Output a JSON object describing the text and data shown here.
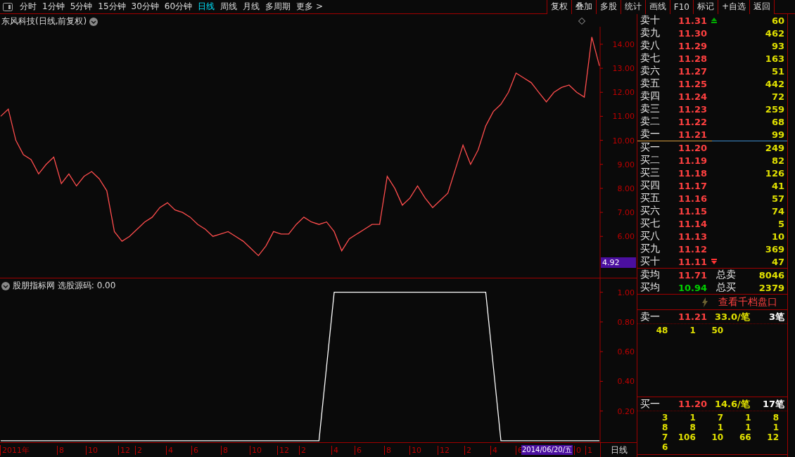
{
  "toolbar": {
    "periods": [
      {
        "label": "分时",
        "selected": false
      },
      {
        "label": "1分钟",
        "selected": false
      },
      {
        "label": "5分钟",
        "selected": false
      },
      {
        "label": "15分钟",
        "selected": false
      },
      {
        "label": "30分钟",
        "selected": false
      },
      {
        "label": "60分钟",
        "selected": false
      },
      {
        "label": "日线",
        "selected": true
      },
      {
        "label": "周线",
        "selected": false
      },
      {
        "label": "月线",
        "selected": false
      },
      {
        "label": "多周期",
        "selected": false
      },
      {
        "label": "更多 >",
        "selected": false
      }
    ],
    "buttons": [
      "复权",
      "叠加",
      "多股",
      "统计",
      "画线",
      "F10",
      "标记",
      "+自选",
      "返回"
    ]
  },
  "main_chart": {
    "title": "东风科技(日线,前复权)",
    "cursor_value": "4.92",
    "chart_data": {
      "type": "line",
      "ylim": [
        4.28,
        14.73
      ],
      "yticks": [
        {
          "value": 6,
          "label": "6.00"
        },
        {
          "value": 7,
          "label": "7.00"
        },
        {
          "value": 8,
          "label": "8.00"
        },
        {
          "value": 9,
          "label": "9.00"
        },
        {
          "value": 10,
          "label": "10.00"
        },
        {
          "value": 11,
          "label": "11.00"
        },
        {
          "value": 12,
          "label": "12.00"
        },
        {
          "value": 13,
          "label": "13.00"
        },
        {
          "value": 14,
          "label": "14.00"
        }
      ],
      "series": [
        {
          "color": "#ff4d4d",
          "values": [
            11.0,
            11.3,
            10.0,
            9.4,
            9.2,
            8.6,
            9.0,
            9.3,
            8.2,
            8.6,
            8.1,
            8.5,
            8.7,
            8.4,
            7.9,
            6.2,
            5.8,
            6.0,
            6.3,
            6.6,
            6.8,
            7.2,
            7.4,
            7.1,
            7.0,
            6.8,
            6.5,
            6.3,
            6.0,
            6.1,
            6.2,
            6.0,
            5.8,
            5.5,
            5.2,
            5.6,
            6.2,
            6.1,
            6.1,
            6.5,
            6.8,
            6.6,
            6.5,
            6.6,
            6.2,
            5.4,
            5.9,
            6.1,
            6.3,
            6.5,
            6.5,
            8.5,
            8.0,
            7.3,
            7.6,
            8.1,
            7.6,
            7.2,
            7.5,
            7.8,
            8.8,
            9.8,
            9.0,
            9.6,
            10.6,
            11.2,
            11.5,
            12.0,
            12.8,
            12.6,
            12.4,
            12.0,
            11.6,
            12.0,
            12.2,
            12.3,
            12.0,
            11.8,
            14.3,
            13.1
          ]
        }
      ]
    }
  },
  "indicator_chart": {
    "title": "股朋指标网 选股源码: 0.00",
    "chart_data": {
      "type": "line",
      "ylim": [
        -0.01,
        1.093
      ],
      "yticks": [
        {
          "value": 0.2,
          "label": "0.20"
        },
        {
          "value": 0.4,
          "label": "0.40"
        },
        {
          "value": 0.6,
          "label": "0.60"
        },
        {
          "value": 0.8,
          "label": "0.80"
        },
        {
          "value": 1,
          "label": "1.00"
        }
      ],
      "series": [
        {
          "color": "#ffffff",
          "values": [
            0,
            0,
            0,
            0,
            0,
            0,
            0,
            0,
            0,
            0,
            0,
            0,
            0,
            0,
            0,
            0,
            0,
            0,
            0,
            0,
            0,
            0,
            0,
            0,
            0,
            0,
            0,
            0,
            0,
            0,
            0,
            0,
            0,
            0,
            0,
            0,
            0,
            0,
            0,
            0,
            0,
            0,
            0,
            0.5,
            1,
            1,
            1,
            1,
            1,
            1,
            1,
            1,
            1,
            1,
            1,
            1,
            1,
            1,
            1,
            1,
            1,
            1,
            1,
            1,
            1,
            0.5,
            0,
            0,
            0,
            0,
            0,
            0,
            0,
            0,
            0,
            0,
            0,
            0,
            0,
            0
          ]
        }
      ]
    }
  },
  "time_axis": [
    {
      "label": "2011年",
      "kind": "tick"
    },
    {
      "label": "8",
      "kind": "tick"
    },
    {
      "label": "10",
      "kind": "tick"
    },
    {
      "label": "12",
      "kind": "tick"
    },
    {
      "label": "2",
      "kind": "tick"
    },
    {
      "label": "4",
      "kind": "tick"
    },
    {
      "label": "6",
      "kind": "tick"
    },
    {
      "label": "8",
      "kind": "tick"
    },
    {
      "label": "10",
      "kind": "tick"
    },
    {
      "label": "12",
      "kind": "tick"
    },
    {
      "label": "2",
      "kind": "tick"
    },
    {
      "label": "4",
      "kind": "tick"
    },
    {
      "label": "6",
      "kind": "tick"
    },
    {
      "label": "8",
      "kind": "tick"
    },
    {
      "label": "10",
      "kind": "tick"
    },
    {
      "label": "12",
      "kind": "tick"
    },
    {
      "label": "2",
      "kind": "tick"
    },
    {
      "label": "4",
      "kind": "tick"
    },
    {
      "label": "6",
      "kind": "tick"
    },
    {
      "label": "2014/06/20/五",
      "kind": "cursor"
    },
    {
      "label": "0",
      "kind": "tick"
    },
    {
      "label": "1",
      "kind": "tick"
    }
  ],
  "period_label": "日线",
  "order_book": {
    "asks": [
      {
        "label": "卖十",
        "price": "11.31",
        "volume": "60",
        "up_arrow": true
      },
      {
        "label": "卖九",
        "price": "11.30",
        "volume": "462"
      },
      {
        "label": "卖八",
        "price": "11.29",
        "volume": "93"
      },
      {
        "label": "卖七",
        "price": "11.28",
        "volume": "163"
      },
      {
        "label": "卖六",
        "price": "11.27",
        "volume": "51"
      },
      {
        "label": "卖五",
        "price": "11.25",
        "volume": "442"
      },
      {
        "label": "卖四",
        "price": "11.24",
        "volume": "72"
      },
      {
        "label": "卖三",
        "price": "11.23",
        "volume": "259"
      },
      {
        "label": "卖二",
        "price": "11.22",
        "volume": "68"
      },
      {
        "label": "卖一",
        "price": "11.21",
        "volume": "99"
      }
    ],
    "bids": [
      {
        "label": "买一",
        "price": "11.20",
        "volume": "249"
      },
      {
        "label": "买二",
        "price": "11.19",
        "volume": "82"
      },
      {
        "label": "买三",
        "price": "11.18",
        "volume": "126"
      },
      {
        "label": "买四",
        "price": "11.17",
        "volume": "41"
      },
      {
        "label": "买五",
        "price": "11.16",
        "volume": "57"
      },
      {
        "label": "买六",
        "price": "11.15",
        "volume": "74"
      },
      {
        "label": "买七",
        "price": "11.14",
        "volume": "5"
      },
      {
        "label": "买八",
        "price": "11.13",
        "volume": "10"
      },
      {
        "label": "买九",
        "price": "11.12",
        "volume": "369"
      },
      {
        "label": "买十",
        "price": "11.11",
        "volume": "47",
        "down_arrow": true
      }
    ],
    "summary": [
      {
        "label": "卖均",
        "price": "11.71",
        "color": "#ff4040",
        "total_label": "总卖",
        "total": "8046"
      },
      {
        "label": "买均",
        "price": "10.94",
        "color": "#00d000",
        "total_label": "总买",
        "total": "2379"
      }
    ],
    "depth_link": "查看千档盘口",
    "queues": [
      {
        "label": "卖一",
        "price": "11.21",
        "average": "33.0/笔",
        "count": "3笔",
        "orders": [
          [
            "48",
            "1",
            "50"
          ]
        ]
      },
      {
        "label": "买一",
        "price": "11.20",
        "average": "14.6/笔",
        "count": "17笔",
        "orders": [
          [
            "3",
            "1",
            "7",
            "1",
            "8"
          ],
          [
            "8",
            "8",
            "1",
            "1",
            "1"
          ],
          [
            "7",
            "106",
            "10",
            "66",
            "12"
          ],
          [
            "6"
          ]
        ]
      }
    ]
  }
}
